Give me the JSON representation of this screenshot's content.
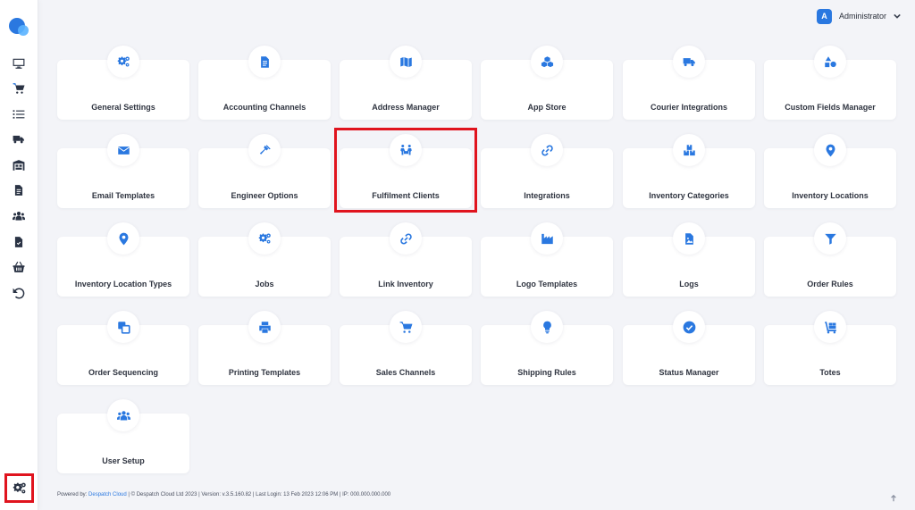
{
  "header": {
    "user_initial": "A",
    "user_name": "Administrator"
  },
  "sidebar": {
    "items": [
      {
        "icon": "monitor-icon"
      },
      {
        "icon": "cart-icon"
      },
      {
        "icon": "list-icon"
      },
      {
        "icon": "truck-icon"
      },
      {
        "icon": "warehouse-icon"
      },
      {
        "icon": "document-icon"
      },
      {
        "icon": "users-icon"
      },
      {
        "icon": "invoice-icon"
      },
      {
        "icon": "basket-icon"
      },
      {
        "icon": "undo-icon"
      }
    ],
    "settings_icon": "cogs-icon"
  },
  "cards": [
    {
      "label": "General Settings",
      "icon": "cogs-icon"
    },
    {
      "label": "Accounting Channels",
      "icon": "document-icon"
    },
    {
      "label": "Address Manager",
      "icon": "map-icon"
    },
    {
      "label": "App Store",
      "icon": "cubes-icon"
    },
    {
      "label": "Courier Integrations",
      "icon": "truck-icon"
    },
    {
      "label": "Custom Fields Manager",
      "icon": "shapes-icon"
    },
    {
      "label": "Email Templates",
      "icon": "envelope-icon"
    },
    {
      "label": "Engineer Options",
      "icon": "hammer-icon"
    },
    {
      "label": "Fulfilment Clients",
      "icon": "people-carry-icon"
    },
    {
      "label": "Integrations",
      "icon": "link-icon"
    },
    {
      "label": "Inventory Categories",
      "icon": "boxes-icon"
    },
    {
      "label": "Inventory Locations",
      "icon": "map-pin-icon"
    },
    {
      "label": "Inventory Location Types",
      "icon": "map-pin-icon"
    },
    {
      "label": "Jobs",
      "icon": "cogs-icon"
    },
    {
      "label": "Link Inventory",
      "icon": "link-icon"
    },
    {
      "label": "Logo Templates",
      "icon": "industry-icon"
    },
    {
      "label": "Logs",
      "icon": "file-image-icon"
    },
    {
      "label": "Order Rules",
      "icon": "filter-icon"
    },
    {
      "label": "Order Sequencing",
      "icon": "clone-icon"
    },
    {
      "label": "Printing Templates",
      "icon": "printer-icon"
    },
    {
      "label": "Sales Channels",
      "icon": "cart-icon"
    },
    {
      "label": "Shipping Rules",
      "icon": "lightbulb-icon"
    },
    {
      "label": "Status Manager",
      "icon": "check-circle-icon"
    },
    {
      "label": "Totes",
      "icon": "dolly-icon"
    },
    {
      "label": "User Setup",
      "icon": "users-icon"
    }
  ],
  "footer": {
    "powered_by": "Powered by: ",
    "brand": "Despatch Cloud",
    "rest": " | © Despatch Cloud Ltd 2023 | Version: v.3.5.160.82 | Last Login: 13 Feb 2023 12:06 PM | IP: 000.000.000.000"
  },
  "colors": {
    "accent": "#2a78e0",
    "highlight": "#e0141e",
    "background": "#f3f4f8"
  }
}
